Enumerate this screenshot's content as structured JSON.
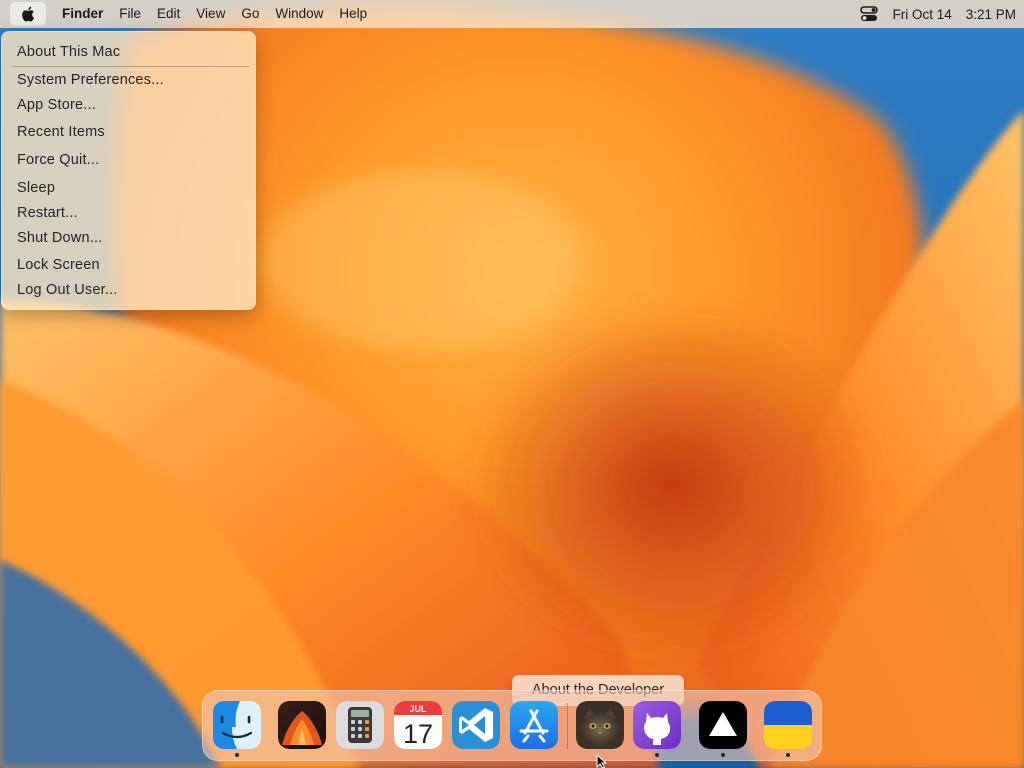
{
  "menubar": {
    "apple_icon": "apple-icon",
    "items": [
      {
        "label": "Finder",
        "bold": true
      },
      {
        "label": "File"
      },
      {
        "label": "Edit"
      },
      {
        "label": "View"
      },
      {
        "label": "Go"
      },
      {
        "label": "Window"
      },
      {
        "label": "Help"
      }
    ],
    "control_center_icon": "control-center-icon",
    "date": "Fri Oct 14",
    "time": "3:21 PM"
  },
  "apple_menu": {
    "items": [
      "About This Mac",
      "System Preferences...",
      "App Store...",
      "Recent Items",
      "Force Quit...",
      "Sleep",
      "Restart...",
      "Shut Down...",
      "Lock Screen",
      "Log Out User..."
    ]
  },
  "dock": {
    "apps": [
      {
        "name": "Finder",
        "icon": "finder-icon",
        "running": true
      },
      {
        "name": "Wallpaper",
        "icon": "wallpaper-icon",
        "running": false
      },
      {
        "name": "Calculator",
        "icon": "calculator-icon",
        "running": false
      },
      {
        "name": "Calendar",
        "icon": "calendar-icon",
        "running": false,
        "month": "JUL",
        "day": "17"
      },
      {
        "name": "VS Code",
        "icon": "vscode-icon",
        "running": false
      },
      {
        "name": "App Store",
        "icon": "app-store-icon",
        "running": false
      },
      {
        "name": "About the Developer",
        "icon": "developer-avatar-icon",
        "running": false
      },
      {
        "name": "GitHub",
        "icon": "github-icon",
        "running": true
      },
      {
        "name": "Vercel",
        "icon": "vercel-icon",
        "running": true
      },
      {
        "name": "Ukraine",
        "icon": "ukraine-flag-icon",
        "running": true
      }
    ],
    "tooltip": "About the Developer"
  },
  "colors": {
    "wallpaper_blue": "#1f6fb5",
    "wallpaper_orange": "#f68a1e",
    "menu_bg": "#f8e2c8"
  }
}
